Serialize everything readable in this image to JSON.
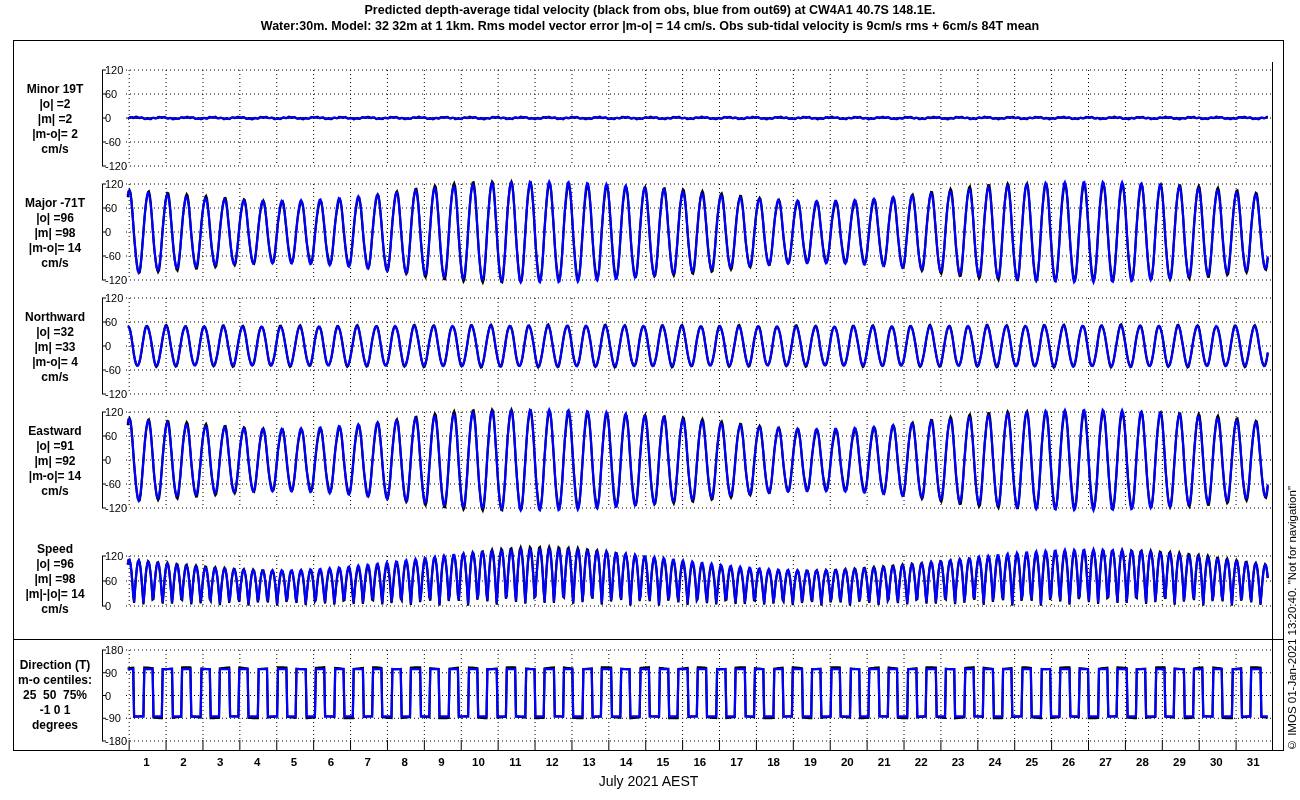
{
  "title_lines": [
    "Predicted depth-average tidal velocity (black from obs, blue from out69) at CW4A1 40.7S 148.1E.",
    "Water:30m. Model: 32 32m at 1 1km. Rms model vector error |m-o| = 14 cm/s. Obs sub-tidal velocity is 9cm/s rms + 6cm/s 84T mean"
  ],
  "velocity_panels": [
    {
      "kind": "flat",
      "label_lines": [
        "Minor 19T",
        "|o| =2",
        "|m| =2",
        "|m-o|= 2",
        "cm/s"
      ],
      "yticks": [
        "120",
        "60",
        "0",
        "-60",
        "-120"
      ]
    },
    {
      "kind": "wave",
      "label_lines": [
        "Major -71T",
        "|o| =96",
        "|m| =98",
        "|m-o|= 14",
        "cm/s"
      ],
      "yticks": [
        "120",
        "60",
        "0",
        "-60",
        "-120"
      ]
    },
    {
      "kind": "small-wave",
      "label_lines": [
        "Northward",
        "|o| =32",
        "|m| =33",
        "|m-o|= 4",
        "cm/s"
      ],
      "yticks": [
        "120",
        "60",
        "0",
        "-60",
        "-120"
      ]
    },
    {
      "kind": "wave",
      "label_lines": [
        "Eastward",
        "|o| =91",
        "|m| =92",
        "|m-o|= 14",
        "cm/s"
      ],
      "yticks": [
        "120",
        "60",
        "0",
        "-60",
        "-120"
      ]
    },
    {
      "kind": "speed",
      "label_lines": [
        "Speed",
        "|o| =96",
        "|m| =98",
        "|m|-|o|= 14",
        "cm/s"
      ],
      "yticks": [
        "120",
        "60",
        "0"
      ]
    }
  ],
  "direction_panel": {
    "kind": "direction",
    "label_lines": [
      "Direction (T)",
      "m-o centiles:",
      "25  50  75%",
      "-1 0 1",
      "degrees"
    ],
    "yticks": [
      "180",
      "90",
      "0",
      "-90",
      "-180"
    ]
  },
  "x_axis": {
    "ticks": [
      "1",
      "2",
      "3",
      "4",
      "5",
      "6",
      "7",
      "8",
      "9",
      "10",
      "11",
      "12",
      "13",
      "14",
      "15",
      "16",
      "17",
      "18",
      "19",
      "20",
      "21",
      "22",
      "23",
      "24",
      "25",
      "26",
      "27",
      "28",
      "29",
      "30",
      "31"
    ],
    "label": "July 2021 AEST"
  },
  "footer": "© IMOS 01-Jan-2021 13:20:40. \"Not for navigation\""
}
